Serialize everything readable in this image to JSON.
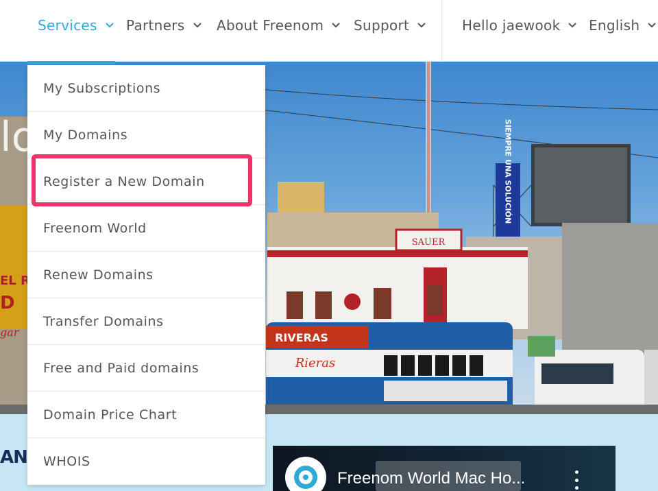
{
  "nav": {
    "items": [
      {
        "label": "Services",
        "active": true
      },
      {
        "label": "Partners",
        "active": false
      },
      {
        "label": "About Freenom",
        "active": false
      },
      {
        "label": "Support",
        "active": false
      }
    ],
    "user": "Hello jaewook",
    "language": "English"
  },
  "services_menu": {
    "items": [
      "My Subscriptions",
      "My Domains",
      "Register a New Domain",
      "Freenom World",
      "Renew Domains",
      "Transfer Domains",
      "Free and Paid domains",
      "Domain Price Chart",
      "WHOIS"
    ],
    "highlighted": "Register a New Domain"
  },
  "hero": {
    "signs": {
      "vertical_sign": "SIEMPRE UNA SOLUCIÓN",
      "building_sign": "SAUER",
      "bus_sign": "RIVERAS",
      "bus_script": "Rieras",
      "left_fragment": "lo"
    }
  },
  "lower": {
    "left_text": "ANC",
    "video_title": "Freenom World Mac Ho..."
  },
  "colors": {
    "accent": "#2fa9d6",
    "highlight": "#f0336b",
    "lower_bg": "#c6e6f6"
  }
}
